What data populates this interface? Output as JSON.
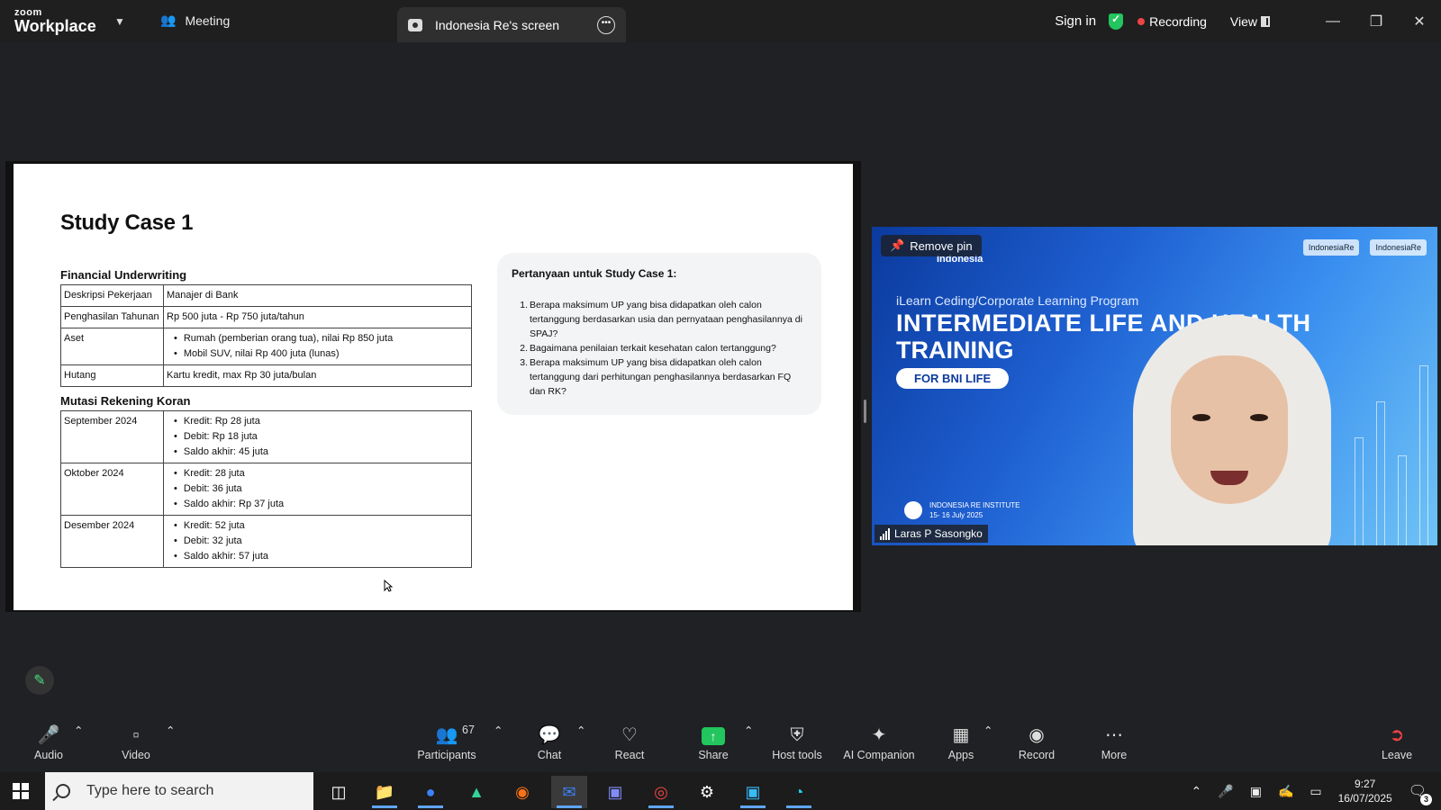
{
  "app": {
    "brand_small": "zoom",
    "brand_name": "Workplace",
    "meeting_tab": "Meeting",
    "screen_tab": "Indonesia Re's screen",
    "sign_in": "Sign in",
    "recording": "Recording",
    "view": "View",
    "colors": {
      "accent_green": "#22c55e",
      "recording_red": "#ef4444"
    }
  },
  "slide": {
    "title": "Study Case 1",
    "financial_title": "Financial Underwriting",
    "financial_rows": [
      {
        "key": "Deskripsi Pekerjaan",
        "value": "Manajer di Bank"
      },
      {
        "key": "Penghasilan Tahunan",
        "value": "Rp 500 juta - Rp 750 juta/tahun"
      },
      {
        "key": "Aset",
        "items": [
          "Rumah (pemberian orang tua), nilai Rp 850 juta",
          "Mobil SUV, nilai Rp 400 juta (lunas)"
        ]
      },
      {
        "key": "Hutang",
        "value": "Kartu kredit, max Rp 30 juta/bulan"
      }
    ],
    "mutasi_title": "Mutasi Rekening Koran",
    "mutasi_rows": [
      {
        "key": "September 2024",
        "items": [
          "Kredit: Rp 28 juta",
          "Debit: Rp 18 juta",
          "Saldo akhir: 45 juta"
        ]
      },
      {
        "key": "Oktober 2024",
        "items": [
          "Kredit: 28 juta",
          "Debit: 36 juta",
          "Saldo akhir: Rp 37 juta"
        ]
      },
      {
        "key": "Desember 2024",
        "items": [
          "Kredit: 52 juta",
          "Debit: 32 juta",
          "Saldo akhir: 57 juta"
        ]
      }
    ],
    "questions_title": "Pertanyaan untuk Study Case 1:",
    "questions": [
      {
        "n": "1.",
        "text": "Berapa maksimum UP yang bisa didapatkan oleh calon tertanggung berdasarkan usia dan pernyataan penghasilannya di SPAJ?"
      },
      {
        "n": "2.",
        "text": "Bagaimana penilaian terkait kesehatan calon tertanggung?"
      },
      {
        "n": "3.",
        "text": "Berapa maksimum UP yang bisa didapatkan oleh calon tertanggung dari perhitungan penghasilannya berdasarkan FQ dan RK?"
      }
    ]
  },
  "video": {
    "remove_pin": "Remove pin",
    "brand_left": "Indonesia",
    "brand_right_1": "IndonesiaRe",
    "brand_right_2": "IndonesiaRe",
    "program": "iLearn Ceding/Corporate Learning Program",
    "title_line1": "INTERMEDIATE LIFE AND HEALTH",
    "title_line2": "TRAINING",
    "pill": "FOR BNI LIFE",
    "institute": "INDONESIA RE INSTITUTE",
    "dates": "15- 16 July 2025",
    "participant_name": "Laras P Sasongko"
  },
  "toolbar": {
    "audio": "Audio",
    "video": "Video",
    "participants": "Participants",
    "participants_count": "67",
    "chat": "Chat",
    "react": "React",
    "share": "Share",
    "host_tools": "Host tools",
    "ai_companion": "AI Companion",
    "apps": "Apps",
    "record": "Record",
    "more": "More",
    "leave": "Leave"
  },
  "taskbar": {
    "search_placeholder": "Type here to search",
    "time": "9:27",
    "date": "16/07/2025",
    "notifications": "3"
  }
}
